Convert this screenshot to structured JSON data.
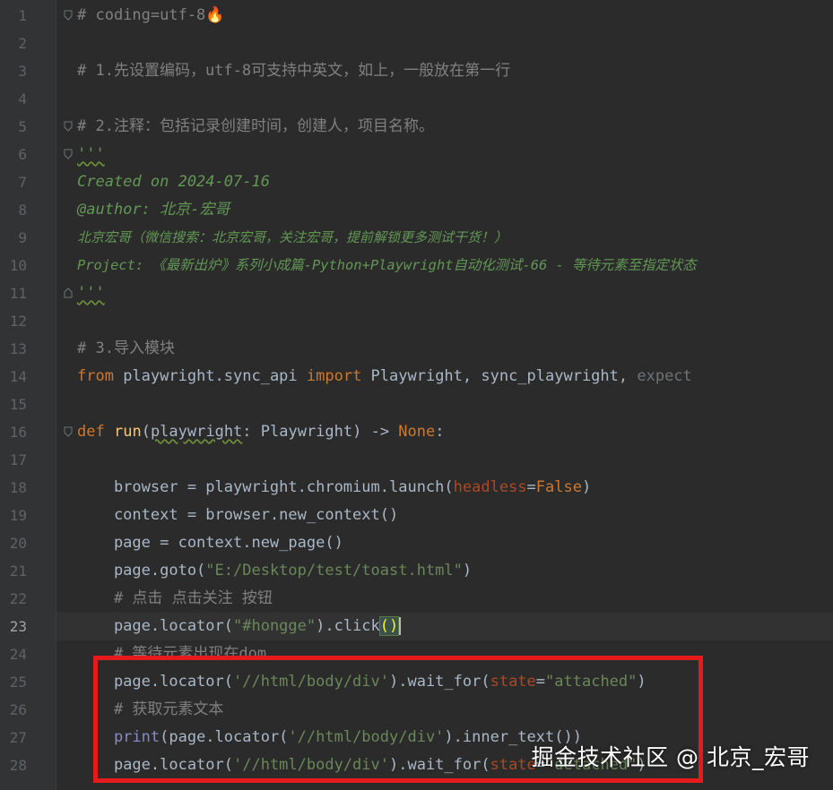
{
  "editor": {
    "current_line": 23,
    "lines": [
      {
        "num": "1"
      },
      {
        "num": "2"
      },
      {
        "num": "3"
      },
      {
        "num": "4"
      },
      {
        "num": "5"
      },
      {
        "num": "6"
      },
      {
        "num": "7"
      },
      {
        "num": "8"
      },
      {
        "num": "9"
      },
      {
        "num": "10"
      },
      {
        "num": "11"
      },
      {
        "num": "12"
      },
      {
        "num": "13"
      },
      {
        "num": "14"
      },
      {
        "num": "15"
      },
      {
        "num": "16"
      },
      {
        "num": "17"
      },
      {
        "num": "18"
      },
      {
        "num": "19"
      },
      {
        "num": "20"
      },
      {
        "num": "21"
      },
      {
        "num": "22"
      },
      {
        "num": "23"
      },
      {
        "num": "24"
      },
      {
        "num": "25"
      },
      {
        "num": "26"
      },
      {
        "num": "27"
      },
      {
        "num": "28"
      }
    ],
    "code": {
      "l1": "# coding=utf-8🔥",
      "l3": "# 1.先设置编码，utf-8可支持中英文，如上，一般放在第一行",
      "l5": "# 2.注释：包括记录创建时间，创建人，项目名称。",
      "l6": "'''",
      "l7": "Created on 2024-07-16",
      "l8": "@author: 北京-宏哥",
      "l9": "北京宏哥（微信搜索：北京宏哥，关注宏哥，提前解锁更多测试干货！）",
      "l10": "Project: 《最新出炉》系列小成篇-Python+Playwright自动化测试-66 - 等待元素至指定状态",
      "l11": "'''",
      "l13": "# 3.导入模块",
      "l14": {
        "kw1": "from",
        "mod": " playwright.sync_api ",
        "kw2": "import",
        "names": " Playwright, sync_playwright,",
        "dim": " expect"
      },
      "l16": {
        "kw": "def",
        "fn": "run",
        "open": "(",
        "param": "playwright",
        "rest": ": Playwright) -> ",
        "none": "None",
        ":": ":"
      },
      "l18": {
        "a": "    browser = playwright.chromium.launch(",
        "p": "headless",
        "eq": "=",
        "v": "False",
        ")": ")"
      },
      "l19": "    context = browser.new_context()",
      "l20": "    page = context.new_page()",
      "l21": {
        "a": "    page.goto(",
        "s": "\"E:/Desktop/test/toast.html\"",
        "b": ")"
      },
      "l22": "    # 点击 点击关注 按钮",
      "l23": {
        "a": "    page.locator(",
        "s": "\"#hongge\"",
        "b": ").click",
        "paren": "()"
      },
      "l24": "    # 等待元素出现在dom",
      "l25": {
        "a": "    page.locator(",
        "s": "'//html/body/div'",
        "b": ").wait_for(",
        "p": "state",
        "eq": "=",
        "v": "\"attached\"",
        "c": ")"
      },
      "l26": "    # 获取元素文本",
      "l27": {
        "fn": "    print",
        "a": "(page.locator(",
        "s": "'//html/body/div'",
        "b": ").inner_text())"
      },
      "l28": {
        "a": "    page.locator(",
        "s": "'//html/body/div'",
        "b": ").wait_for(",
        "p": "state",
        "eq": "=",
        "v": "\"detached\"",
        "c": ")"
      }
    }
  },
  "watermark": "掘金技术社区 @ 北京_宏哥",
  "colors": {
    "highlight_box": "#e51a1a",
    "background": "#2b2b2b",
    "gutter": "#313335"
  }
}
